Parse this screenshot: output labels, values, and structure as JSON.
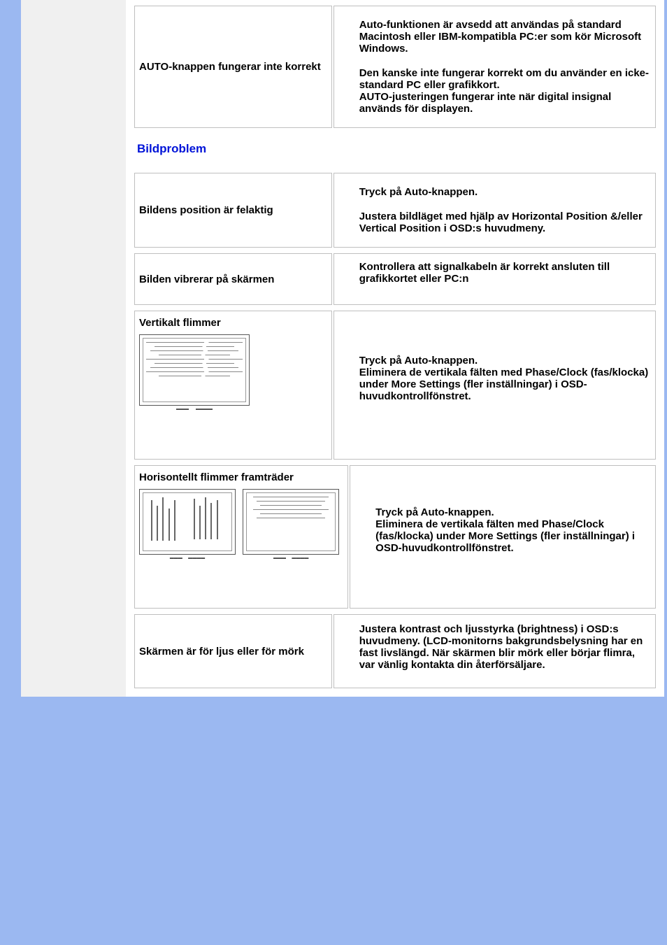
{
  "rows": {
    "auto_button": {
      "problem": "AUTO-knappen fungerar inte korrekt",
      "solution_p1": "Auto-funktionen är avsedd att användas på standard Macintosh eller IBM-kompatibla PC:er som kör Microsoft Windows.",
      "solution_p2a": "Den kanske inte fungerar korrekt om du använder en icke-standard PC eller grafikkort.",
      "solution_p2b": "AUTO-justeringen fungerar inte när digital insignal används för displayen."
    },
    "section_heading": "Bildproblem",
    "position": {
      "problem": "Bildens position är felaktig",
      "solution_p1": "Tryck på Auto-knappen.",
      "solution_p2": "Justera bildläget med hjälp av Horizontal Position &/eller Vertical Position i OSD:s huvudmeny."
    },
    "vibrate": {
      "problem": "Bilden vibrerar på skärmen",
      "solution": "Kontrollera att signalkabeln är korrekt ansluten till grafikkortet eller PC:n"
    },
    "vflicker": {
      "problem": "Vertikalt flimmer",
      "solution_p1": "Tryck på Auto-knappen.",
      "solution_p2": "Eliminera de vertikala fälten med Phase/Clock (fas/klocka) under More Settings (fler inställningar) i OSD-huvudkontrollfönstret."
    },
    "hflicker": {
      "problem": "Horisontellt flimmer framträder",
      "solution_p1": "Tryck på Auto-knappen.",
      "solution_p2": "Eliminera de vertikala fälten med Phase/Clock (fas/klocka) under More Settings (fler inställningar) i OSD-huvudkontrollfönstret."
    },
    "brightness": {
      "problem": "Skärmen är för ljus eller för mörk",
      "solution": "Justera kontrast och ljusstyrka (brightness) i OSD:s huvudmeny. (LCD-monitorns bakgrundsbelysning har en fast livslängd. När skärmen blir mörk eller börjar flimra, var vänlig kontakta din återförsäljare."
    }
  }
}
